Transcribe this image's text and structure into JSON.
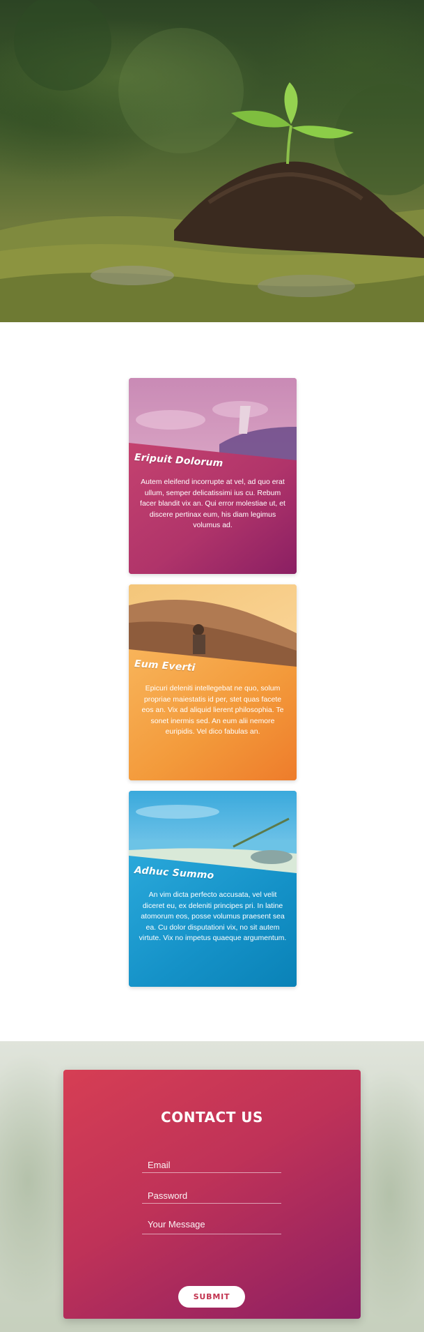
{
  "hero": {
    "icon": "seedling-photo"
  },
  "cards": [
    {
      "title": "Eripuit Dolorum",
      "text": "Autem eleifend incorrupte at vel, ad quo erat ullum, semper delicatissimi ius cu. Rebum facer blandit vix an. Qui error molestiae ut, et discere pertinax eum, his diam legimus volumus ad.",
      "color": "#b33a6a"
    },
    {
      "title": "Eum Everti",
      "text": "Epicuri deleniti intellegebat ne quo, solum propriae maiestatis id per, stet quas facete eos an. Vix ad aliquid lierent philosophia. Te sonet inermis sed. An eum alii nemore euripidis. Vel dico fabulas an.",
      "color": "#f39a3b"
    },
    {
      "title": "Adhuc Summo",
      "text": "An vim dicta perfecto accusata, vel velit diceret eu, ex deleniti principes pri. In latine atomorum eos, posse volumus praesent sea ea. Cu dolor disputationi vix, no sit autem virtute. Vix no impetus quaeque argumentum.",
      "color": "#1592c8"
    }
  ],
  "contact": {
    "title": "CONTACT US",
    "email_placeholder": "Email",
    "password_placeholder": "Password",
    "message_placeholder": "Your Message",
    "submit_label": "SUBMIT",
    "accent": "#c2334f"
  }
}
